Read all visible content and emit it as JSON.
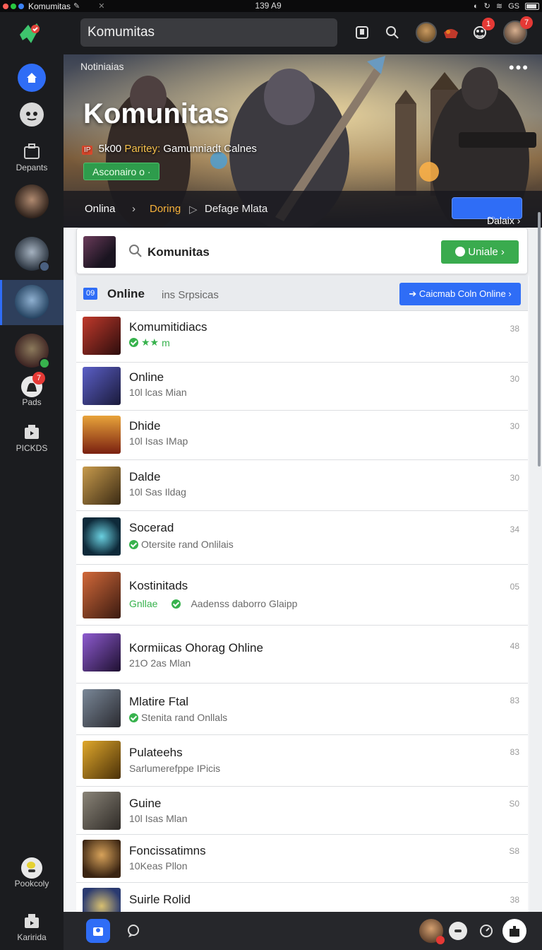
{
  "statusbar": {
    "app_title": "Komumitas",
    "time": "139 A9",
    "network": "GS"
  },
  "topbar": {
    "search_value": "Komumitas",
    "notif_badge_1": "1",
    "notif_badge_2": "7"
  },
  "sidebar": {
    "items": [
      {
        "label": "Depants"
      },
      {
        "label": "Pads",
        "badge": "7"
      },
      {
        "label": "PICKDS"
      },
      {
        "label": "Pookcoly"
      },
      {
        "label": "Karirida"
      }
    ]
  },
  "hero": {
    "label": "Notiniaias",
    "title": "Komunitas",
    "tag": "IP",
    "subtitle_a": "5k00",
    "subtitle_b": "Paritey:",
    "subtitle_c": "Gamunniadt Calnes",
    "join_label": "Asconairo o ·",
    "nav": [
      "Onlina",
      "Doring",
      "Defage Mlata"
    ],
    "details_label": "Dalaix ›"
  },
  "panel": {
    "card_title": "Komunitas",
    "unite_label": "Uniale ›",
    "online_count": "09",
    "online_label": "Online",
    "online_sub": "ins Srpsicas",
    "online_btn": "Caicmab Coln Online ›"
  },
  "list": [
    {
      "title": "Komumitidiacs",
      "sub": "m",
      "num": "38",
      "stars": true
    },
    {
      "title": "Online",
      "sub": "10l lcas Mian",
      "num": "30"
    },
    {
      "title": "Dhide",
      "sub": "10l Isas IMap",
      "num": "30"
    },
    {
      "title": "Dalde",
      "sub": "10l Sas Ildag",
      "num": "30"
    },
    {
      "title": "Socerad",
      "sub": "Otersite rand Onlilais",
      "num": "34",
      "check": true
    },
    {
      "title": "Kostinitads",
      "sub_green": "Gnllae",
      "sub": "Aadenss daborro Glaipp",
      "num": "05",
      "check": true
    },
    {
      "title": "Kormiicas Ohorag Ohline",
      "sub": "21O 2as Mlan",
      "num": "48"
    },
    {
      "title": "Mlatire Ftal",
      "sub": "Stenita rand Onllals",
      "num": "83",
      "check": true
    },
    {
      "title": "Pulateehs",
      "sub": "Sarlumerefppe IPicis",
      "num": "83"
    },
    {
      "title": "Guine",
      "sub": "10l Isas Mlan",
      "num": "S0"
    },
    {
      "title": "Foncissatimns",
      "sub": "10Keas Pllon",
      "num": "S8"
    },
    {
      "title": "Suirle Rolid",
      "sub": "",
      "num": "38"
    }
  ],
  "colors": {
    "accent_blue": "#2f6df6",
    "accent_green": "#3aab4e",
    "badge_red": "#e53935"
  }
}
